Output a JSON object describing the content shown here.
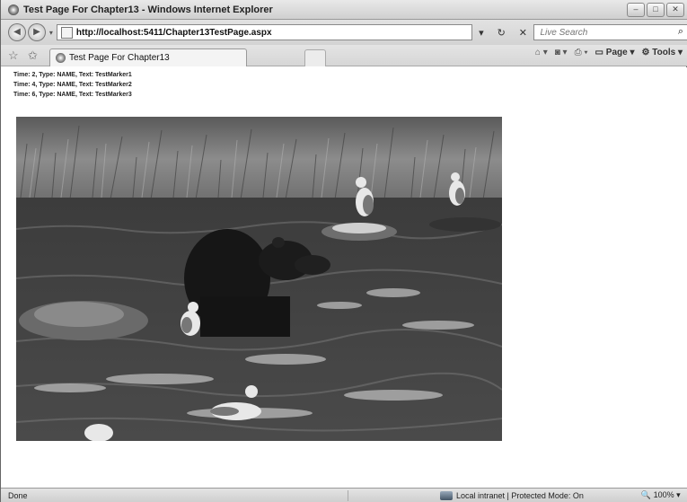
{
  "window": {
    "title": "Test Page For Chapter13 - Windows Internet Explorer"
  },
  "address_bar": {
    "url": "http://localhost:5411/Chapter13TestPage.aspx"
  },
  "search": {
    "placeholder": "Live Search"
  },
  "tab": {
    "label": "Test Page For Chapter13"
  },
  "command_bar": {
    "page_label": "Page",
    "tools_label": "Tools"
  },
  "markers": [
    "Time: 2, Type: NAME, Text: TestMarker1",
    "Time: 4, Type: NAME, Text: TestMarker2",
    "Time: 6, Type: NAME, Text: TestMarker3"
  ],
  "status_bar": {
    "status": "Done",
    "zone": "Local intranet | Protected Mode: On",
    "zoom": "100%"
  }
}
